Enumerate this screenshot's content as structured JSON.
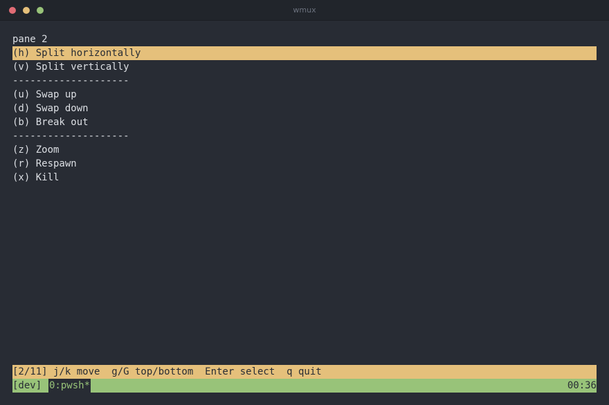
{
  "window": {
    "title": "wmux"
  },
  "menu": {
    "header": "pane 2",
    "items": [
      {
        "text": "(h) Split horizontally",
        "selected": true,
        "separator": false
      },
      {
        "text": "(v) Split vertically",
        "selected": false,
        "separator": false
      },
      {
        "text": "--------------------",
        "selected": false,
        "separator": true
      },
      {
        "text": "(u) Swap up",
        "selected": false,
        "separator": false
      },
      {
        "text": "(d) Swap down",
        "selected": false,
        "separator": false
      },
      {
        "text": "(b) Break out",
        "selected": false,
        "separator": false
      },
      {
        "text": "--------------------",
        "selected": false,
        "separator": true
      },
      {
        "text": "(z) Zoom",
        "selected": false,
        "separator": false
      },
      {
        "text": "(r) Respawn",
        "selected": false,
        "separator": false
      },
      {
        "text": "(x) Kill",
        "selected": false,
        "separator": false
      }
    ]
  },
  "help": {
    "text": "[2/11] j/k move  g/G top/bottom  Enter select  q quit"
  },
  "status": {
    "session": "[dev] ",
    "window": "0:pwsh*",
    "clock": "00:36"
  },
  "colors": {
    "background": "#282c34",
    "highlight": "#e5c07b",
    "status": "#98c379",
    "text": "#dcdfe4"
  }
}
